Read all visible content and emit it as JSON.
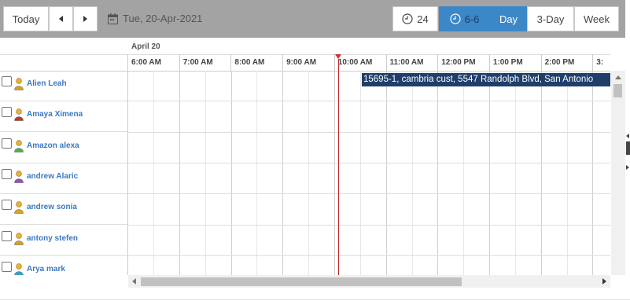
{
  "toolbar": {
    "today_label": "Today",
    "prev_icon": "caret-left-icon",
    "next_icon": "caret-right-icon",
    "date_icon": "calendar-icon",
    "date_text": "Tue, 20-Apr-2021",
    "hours24_label": "24",
    "hours66_label": "6-6",
    "day_label": "Day",
    "threeday_label": "3-Day",
    "week_label": "Week",
    "accent_color": "#3c87c7"
  },
  "timeline": {
    "date_label": "April 20",
    "times": [
      "6:00 AM",
      "7:00 AM",
      "8:00 AM",
      "9:00 AM",
      "10:00 AM",
      "11:00 AM",
      "12:00 PM",
      "1:00 PM",
      "2:00 PM",
      "3:"
    ]
  },
  "resources": [
    {
      "name": "Alien Leah",
      "color": "#d9a21f"
    },
    {
      "name": "Amaya Ximena",
      "color": "#c0392b"
    },
    {
      "name": "Amazon alexa",
      "color": "#4caf50"
    },
    {
      "name": "andrew Alaric",
      "color": "#9b4dca"
    },
    {
      "name": "andrew sonia",
      "color": "#d9a21f"
    },
    {
      "name": "antony stefen",
      "color": "#d9a21f"
    },
    {
      "name": "Arya mark",
      "color": "#3aa0c8"
    }
  ],
  "event": {
    "text": "15695-1, cambria cust, 5547 Randolph Blvd, San Antonio",
    "color": "#1f3f6a"
  },
  "now_indicator_color": "#c0262c"
}
